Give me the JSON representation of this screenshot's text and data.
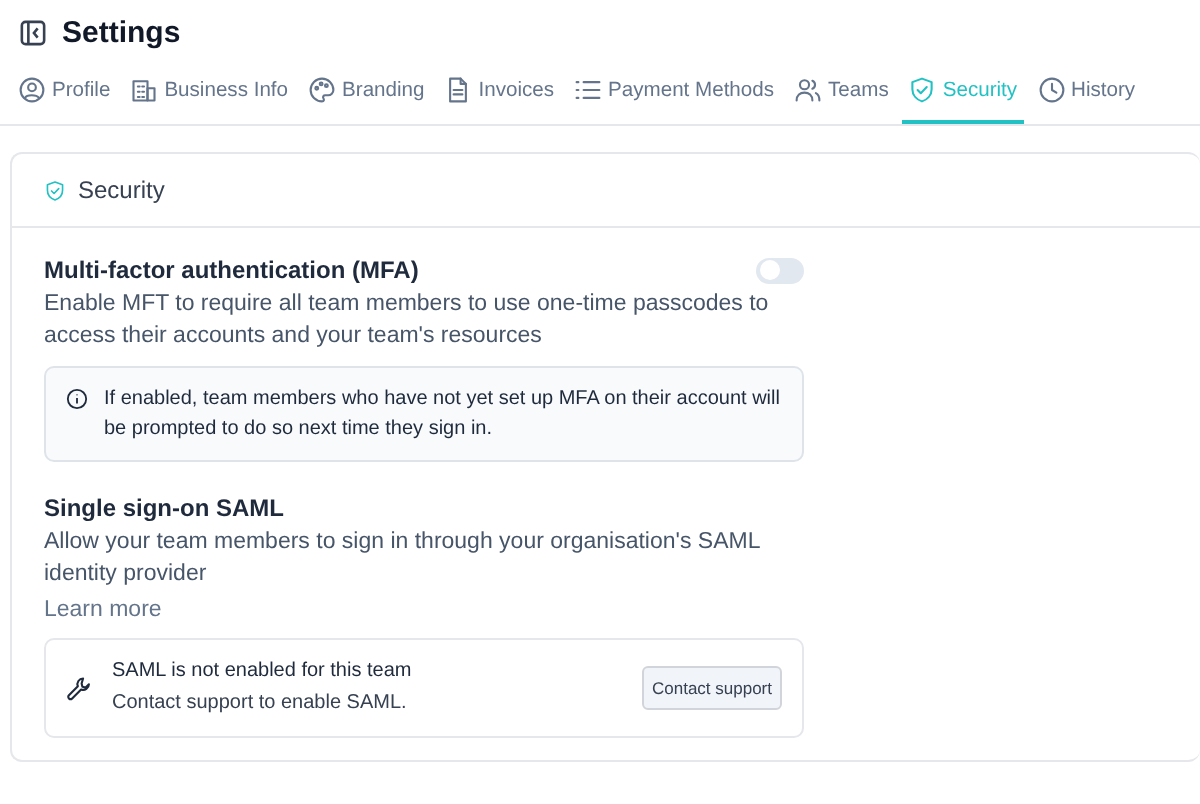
{
  "header": {
    "title": "Settings"
  },
  "tabs": [
    {
      "label": "Profile",
      "selected": false
    },
    {
      "label": "Business Info",
      "selected": false
    },
    {
      "label": "Branding",
      "selected": false
    },
    {
      "label": "Invoices",
      "selected": false
    },
    {
      "label": "Payment Methods",
      "selected": false
    },
    {
      "label": "Teams",
      "selected": false
    },
    {
      "label": "Security",
      "selected": true
    },
    {
      "label": "History",
      "selected": false
    }
  ],
  "card": {
    "title": "Security",
    "mfa": {
      "title": "Multi-factor authentication (MFA)",
      "description": "Enable MFT to require all team members to use one-time passcodes to access their accounts and your team's resources",
      "on": false,
      "notice": "If enabled, team members who have not yet set up MFA on their account will be prompted to do so next time they sign in."
    },
    "sso": {
      "title": "Single sign-on SAML",
      "description": "Allow your team members to sign in through your organisation's SAML identity provider",
      "link": "Learn more",
      "status_title": "SAML is not enabled for this team",
      "status_text": "Contact support to enable SAML.",
      "button": "Contact support"
    }
  }
}
